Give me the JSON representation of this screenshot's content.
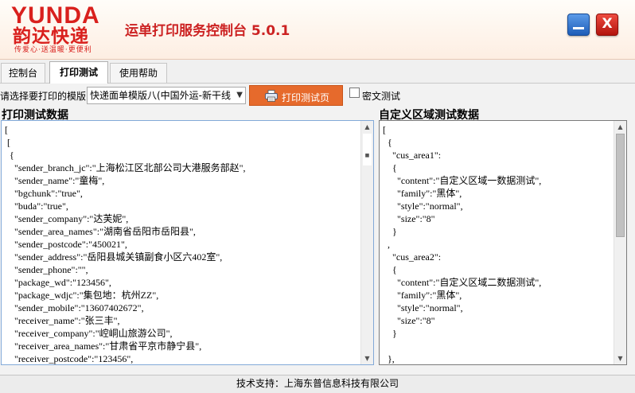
{
  "header": {
    "logo_text": "YUNDA",
    "logo_cn": "韵达快递",
    "logo_slogan": "传爱心·送温暖·更便利",
    "app_title": "运单打印服务控制台 5.0.1",
    "close_glyph": "X"
  },
  "tabs": [
    {
      "label": "控制台"
    },
    {
      "label": "打印测试"
    },
    {
      "label": "使用帮助"
    }
  ],
  "toolbar": {
    "template_label": "请选择要打印的模版",
    "template_value": "快递面单模版八(中国外运-新干线",
    "print_button": "打印测试页",
    "cipher_label": "密文测试"
  },
  "panels": {
    "left_title": "打印测试数据",
    "right_title": "自定义区域测试数据"
  },
  "left_code": "[\n [\n  {\n    \"sender_branch_jc\":\"上海松江区北部公司大港服务部赵\",\n    \"sender_name\":\"童梅\",\n    \"bgchunk\":\"true\",\n    \"buda\":\"true\",\n    \"sender_company\":\"达芙妮\",\n    \"sender_area_names\":\"湖南省岳阳市岳阳县\",\n    \"sender_postcode\":\"450021\",\n    \"sender_address\":\"岳阳县城关镇副食小区六402室\",\n    \"sender_phone\":\"\",\n    \"package_wd\":\"123456\",\n    \"package_wdjc\":\"集包地：杭州ZZ\",\n    \"sender_mobile\":\"13607402672\",\n    \"receiver_name\":\"张三丰\",\n    \"receiver_company\":\"崆峒山旅游公司\",\n    \"receiver_area_names\":\"甘肃省平京市静宁县\",\n    \"receiver_postcode\":\"123456\",",
  "right_code": "[\n  {\n    \"cus_area1\":\n    {\n      \"content\":\"自定义区域一数据测试\",\n      \"family\":\"黑体\",\n      \"style\":\"normal\",\n      \"size\":\"8\"\n    }\n  ,\n    \"cus_area2\":\n    {\n      \"content\":\"自定义区域二数据测试\",\n      \"family\":\"黑体\",\n      \"style\":\"normal\",\n      \"size\":\"8\"\n    }\n\n  },",
  "footer": {
    "text": "技术支持：上海东普信息科技有限公司"
  }
}
